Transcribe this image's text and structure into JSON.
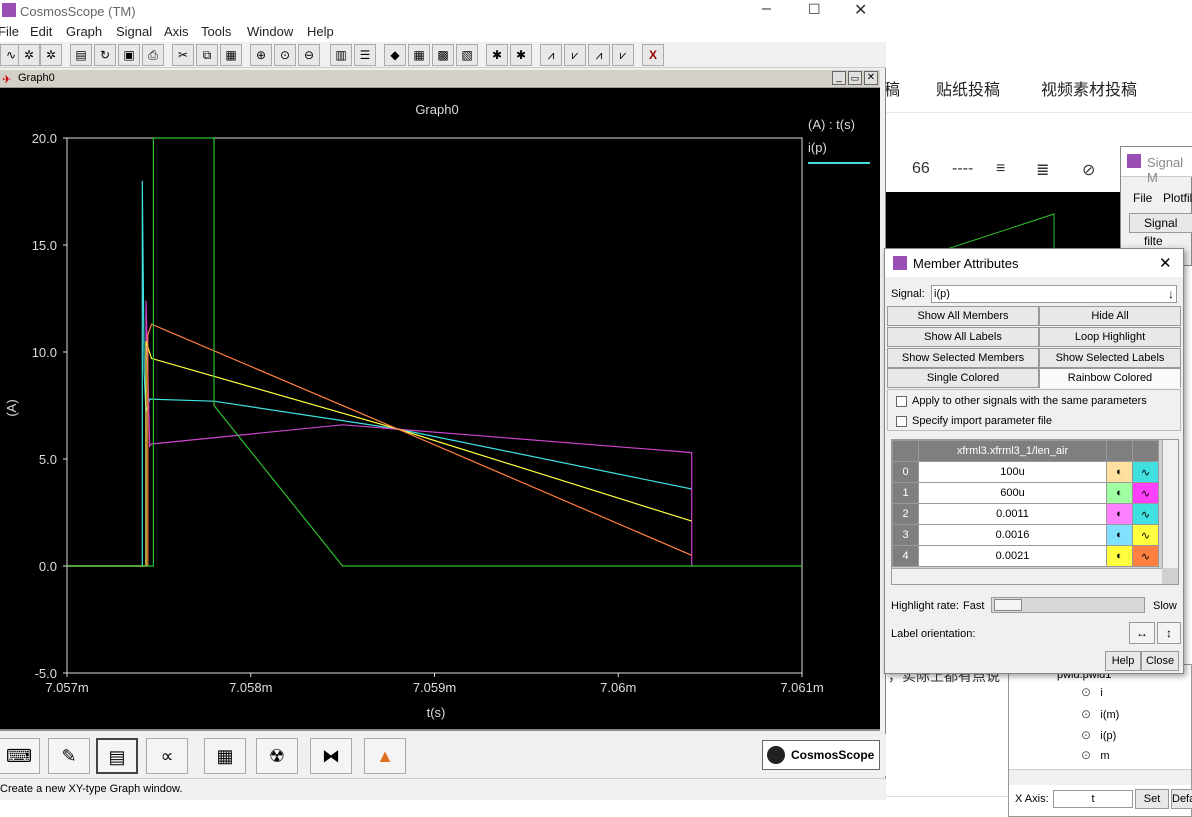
{
  "app": {
    "title": "CosmosScope (TM)",
    "menu": [
      "File",
      "Edit",
      "Graph",
      "Signal",
      "Axis",
      "Tools",
      "Window",
      "Help"
    ],
    "status_text": "Create a new XY-type Graph window.",
    "logo_text": "CosmosScope"
  },
  "background": {
    "tabs": [
      "稿",
      "贴纸投稿",
      "视频素材投稿"
    ],
    "toolbar": [
      "66",
      "----",
      "≡",
      "≣",
      "⊘"
    ],
    "fragment_text": "，实际上都有点说"
  },
  "graph": {
    "window_title": "Graph0",
    "plot_title": "Graph0",
    "legend_header": "(A) : t(s)",
    "legend_signal": "i(p)",
    "ylabel": "(A)",
    "xlabel": "t(s)"
  },
  "chart_data": {
    "type": "line",
    "title": "Graph0",
    "xlabel": "t(s)",
    "ylabel": "(A)",
    "xlim": [
      7.057,
      7.061
    ],
    "ylim": [
      -5.0,
      20.0
    ],
    "x_ticks": [
      "7.057m",
      "7.058m",
      "7.059m",
      "7.06m",
      "7.061m"
    ],
    "y_ticks": [
      "20.0",
      "15.0",
      "10.0",
      "5.0",
      "0.0",
      "-5.0"
    ],
    "grid": false,
    "legend": "right",
    "series": [
      {
        "color": "#40e0e0",
        "points": [
          [
            7.057,
            0
          ],
          [
            7.05741,
            0
          ],
          [
            7.05741,
            18.0
          ],
          [
            7.05742,
            9.0
          ],
          [
            7.05743,
            7.2
          ],
          [
            7.05745,
            7.8
          ],
          [
            7.0578,
            7.7
          ],
          [
            7.0588,
            6.4
          ],
          [
            7.0604,
            3.6
          ]
        ]
      },
      {
        "color": "#cc44cc",
        "points": [
          [
            7.057,
            0
          ],
          [
            7.05743,
            0
          ],
          [
            7.05743,
            12.4
          ],
          [
            7.05745,
            5.6
          ],
          [
            7.05746,
            5.7
          ],
          [
            7.0585,
            6.6
          ],
          [
            7.0604,
            5.3
          ],
          [
            7.0604,
            0
          ]
        ]
      },
      {
        "color": "#ffff40",
        "points": [
          [
            7.057,
            0
          ],
          [
            7.05743,
            0
          ],
          [
            7.05743,
            10.5
          ],
          [
            7.05746,
            9.7
          ],
          [
            7.0588,
            6.4
          ],
          [
            7.0604,
            2.1
          ]
        ]
      },
      {
        "color": "#ff8040",
        "points": [
          [
            7.057,
            0
          ],
          [
            7.05744,
            0
          ],
          [
            7.05744,
            10.8
          ],
          [
            7.05746,
            11.3
          ],
          [
            7.0588,
            6.4
          ],
          [
            7.0604,
            0.5
          ]
        ]
      },
      {
        "color": "#30c030",
        "points": [
          [
            7.057,
            0
          ],
          [
            7.05747,
            0
          ],
          [
            7.05747,
            20.0
          ],
          [
            7.0578,
            20.0
          ],
          [
            7.0578,
            7.5
          ],
          [
            7.0585,
            0
          ],
          [
            7.061,
            0
          ]
        ]
      }
    ]
  },
  "member_dialog": {
    "title": "Member Attributes",
    "signal_label": "Signal:",
    "signal_value": "i(p)",
    "buttons": {
      "show_all_members": "Show All Members",
      "hide_all": "Hide All",
      "show_all_labels": "Show All Labels",
      "loop_highlight": "Loop Highlight",
      "show_selected_members": "Show Selected Members",
      "show_selected_labels": "Show Selected Labels",
      "single_colored": "Single Colored",
      "rainbow_colored": "Rainbow Colored",
      "help": "Help",
      "close": "Close"
    },
    "checkbox_apply": "Apply to other signals with the same parameters",
    "checkbox_import": "Specify import parameter file",
    "param_header": "xfrml3.xfrml3_1/len_air",
    "rows": [
      {
        "index": "0",
        "value": "100u"
      },
      {
        "index": "1",
        "value": "600u"
      },
      {
        "index": "2",
        "value": "0.0011"
      },
      {
        "index": "3",
        "value": "0.0016"
      },
      {
        "index": "4",
        "value": "0.0021"
      }
    ],
    "highlight_label": "Highlight rate:",
    "highlight_fast": "Fast",
    "highlight_slow": "Slow",
    "label_orientation": "Label orientation:"
  },
  "signal_manager": {
    "title": "Signal M",
    "menu": [
      "File",
      "Plotfile"
    ],
    "filter_button": "Signal filte",
    "tree_root": "pwld.pwld1",
    "tree_items": [
      "i",
      "i(m)",
      "i(p)",
      "m"
    ],
    "xaxis_label": "X Axis:",
    "xaxis_value": "t",
    "set_button": "Set",
    "default_button": "Defau"
  }
}
